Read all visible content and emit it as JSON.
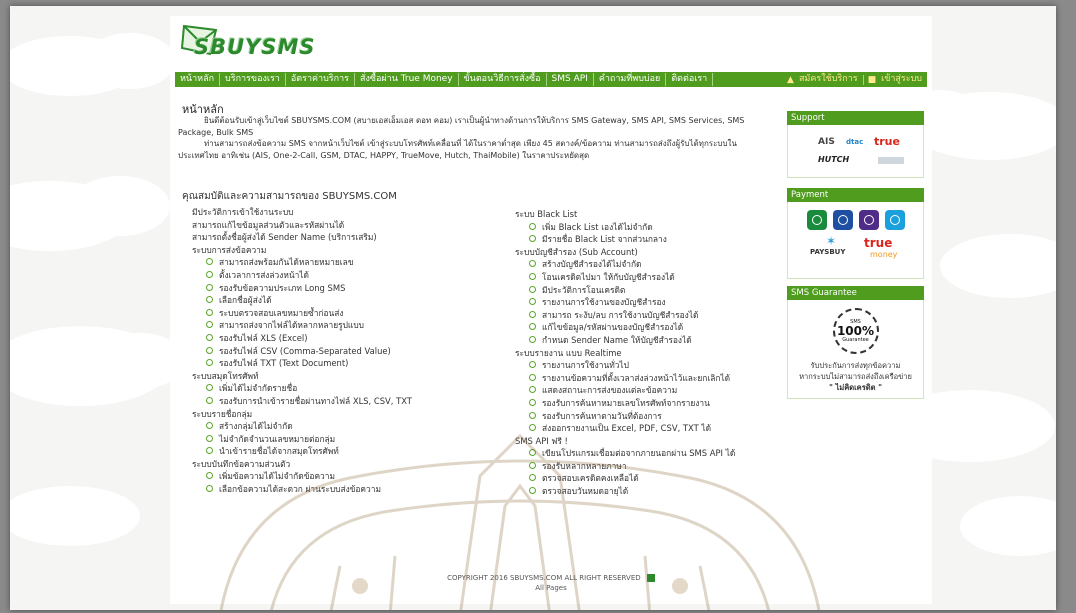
{
  "logo": {
    "text": "SBUYSMS"
  },
  "nav": {
    "items": [
      "หน้าหลัก",
      "บริการของเรา",
      "อัตราค่าบริการ",
      "สั่งซื้อผ่าน True Money",
      "ขั้นตอนวิธีการสั่งซื้อ",
      "SMS API",
      "คำถามที่พบบ่อย",
      "ติดต่อเรา"
    ],
    "register": "สมัครใช้บริการ",
    "login": "เข้าสู่ระบบ"
  },
  "page": {
    "title": "หน้าหลัก",
    "intro1": "ยินดีต้อนรับเข้าสู่เว็บไซต์ SBUYSMS.COM (สบายเอสเอ็มเอส ดอท คอม) เราเป็นผู้นำทางด้านการให้บริการ SMS Gateway, SMS API, SMS Services, SMS Package, Bulk SMS",
    "intro2": "ท่านสามารถส่งข้อความ SMS จากหน้าเว็บไซต์ เข้าสู่ระบบโทรศัพท์เคลื่อนที่ ได้ในราคาต่ำสุด เพียง 45 สตางค์/ข้อความ ท่านสามารถส่งถึงผู้รับได้ทุกระบบในประเทศไทย อาทิเช่น (AIS, One-2-Call, GSM, DTAC, HAPPY, TrueMove, Hutch, ThaiMobile) ในราคาประหยัดสุด",
    "features_title": "คุณสมบัติและความสามารถของ SBUYSMS.COM"
  },
  "features_left": [
    {
      "type": "sec",
      "text": "มีประวัติการเข้าใช้งานระบบ"
    },
    {
      "type": "sec",
      "text": "สามารถแก้ไขข้อมูลส่วนตัวและรหัสผ่านได้"
    },
    {
      "type": "sec",
      "text": "สามารถตั้งชื่อผู้ส่งได้ Sender Name (บริการเสริม)"
    },
    {
      "type": "sec",
      "text": "ระบบการส่งข้อความ"
    },
    {
      "type": "sub",
      "text": "สามารถส่งพร้อมกันได้หลายหมายเลข"
    },
    {
      "type": "sub",
      "text": "ตั้งเวลาการส่งล่วงหน้าได้"
    },
    {
      "type": "sub",
      "text": "รองรับข้อความประเภท Long SMS"
    },
    {
      "type": "sub",
      "text": "เลือกชื่อผู้ส่งได้"
    },
    {
      "type": "sub",
      "text": "ระบบตรวจสอบเลขหมายซ้ำก่อนส่ง"
    },
    {
      "type": "sub",
      "text": "สามารถส่งจากไฟล์ได้หลากหลายรูปแบบ"
    },
    {
      "type": "sub",
      "text": "รองรับไฟล์ XLS (Excel)"
    },
    {
      "type": "sub",
      "text": "รองรับไฟล์ CSV (Comma-Separated Value)"
    },
    {
      "type": "sub",
      "text": "รองรับไฟล์ TXT (Text Document)"
    },
    {
      "type": "sec",
      "text": "ระบบสมุดโทรศัพท์"
    },
    {
      "type": "sub",
      "text": "เพิ่มได้ไม่จำกัดรายชื่อ"
    },
    {
      "type": "sub",
      "text": "รองรับการนำเข้ารายชื่อผ่านทางไฟล์ XLS, CSV, TXT"
    },
    {
      "type": "sec",
      "text": "ระบบรายชื่อกลุ่ม"
    },
    {
      "type": "sub",
      "text": "สร้างกลุ่มได้ไม่จำกัด"
    },
    {
      "type": "sub",
      "text": "ไม่จำกัดจำนวนเลขหมายต่อกลุ่ม"
    },
    {
      "type": "sub",
      "text": "นำเข้ารายชื่อได้จากสมุดโทรศัพท์"
    },
    {
      "type": "sec",
      "text": "ระบบบันทึกข้อความส่วนตัว"
    },
    {
      "type": "sub",
      "text": "เพิ่มข้อความได้ไม่จำกัดข้อความ"
    },
    {
      "type": "sub",
      "text": "เลือกข้อความได้สะดวก ผ่านระบบส่งข้อความ"
    }
  ],
  "features_right": [
    {
      "type": "sec",
      "text": "ระบบ Black List"
    },
    {
      "type": "sub",
      "text": "เพิ่ม Black List เองได้ไม่จำกัด"
    },
    {
      "type": "sub",
      "text": "มีรายชื่อ Black List จากส่วนกลาง"
    },
    {
      "type": "sec",
      "text": "ระบบบัญชีสำรอง (Sub Account)"
    },
    {
      "type": "sub",
      "text": "สร้างบัญชีสำรองได้ไม่จำกัด"
    },
    {
      "type": "sub",
      "text": "โอนเครดิตไปมา ให้กับบัญชีสำรองได้"
    },
    {
      "type": "sub",
      "text": "มีประวัติการโอนเครดิต"
    },
    {
      "type": "sub",
      "text": "รายงานการใช้งานของบัญชีสำรอง"
    },
    {
      "type": "sub",
      "text": "สามารถ ระงับ/ลบ การใช้งานบัญชีสำรองได้"
    },
    {
      "type": "sub",
      "text": "แก้ไขข้อมูล/รหัสผ่านของบัญชีสำรองได้"
    },
    {
      "type": "sub",
      "text": "กำหนด Sender Name ให้บัญชีสำรองได้"
    },
    {
      "type": "sec",
      "text": "ระบบรายงาน แบบ Realtime"
    },
    {
      "type": "sub",
      "text": "รายงานการใช้งานทั่วไป"
    },
    {
      "type": "sub",
      "text": "รายงานข้อความที่ตั้งเวลาส่งล่วงหน้าไว้และยกเลิกได้"
    },
    {
      "type": "sub",
      "text": "แสดงสถานะการส่งของแต่ละข้อความ"
    },
    {
      "type": "sub",
      "text": "รองรับการค้นหาหมายเลขโทรศัพท์จากรายงาน"
    },
    {
      "type": "sub",
      "text": "รองรับการค้นหาตามวันที่ต้องการ"
    },
    {
      "type": "sub",
      "text": "ส่งออกรายงานเป็น Excel, PDF, CSV, TXT ได้"
    },
    {
      "type": "sec",
      "text": "SMS API ฟรี !"
    },
    {
      "type": "sub",
      "text": "เขียนโปรแกรมเชื่อมต่อจากภายนอกผ่าน SMS API ได้"
    },
    {
      "type": "sub",
      "text": "รองรับหลากหลายภาษา"
    },
    {
      "type": "sub",
      "text": "ตรวจสอบเครดิตคงเหลือได้"
    },
    {
      "type": "sub",
      "text": "ตรวจสอบวันหมดอายุได้"
    }
  ],
  "sidebar": {
    "support_title": "Support",
    "payment_title": "Payment",
    "guarantee_title": "SMS Guarantee",
    "carriers": {
      "ais": "AIS",
      "dtac": "dtac",
      "true": "true",
      "hutch": "HUTCH"
    },
    "paysbuy": "PAYSBUY",
    "truemoney_a": "true",
    "truemoney_b": "money",
    "badge_top": "SMS",
    "badge_pct": "100%",
    "badge_bottom": "Guarantee",
    "guarantee_line1": "รับประกันการส่งทุกข้อความ",
    "guarantee_line2": "หากระบบไม่สามารถส่งถึงเครือข่าย",
    "guarantee_line3": "\" ไม่คิดเครดิต \""
  },
  "footer": {
    "copyright": "COPYRIGHT 2016 SBUYSMS.COM ALL RIGHT RESERVED",
    "links": "All Pages"
  },
  "colors": {
    "brand_green": "#4f9c1f",
    "accent_yellow": "#ffe98a"
  }
}
